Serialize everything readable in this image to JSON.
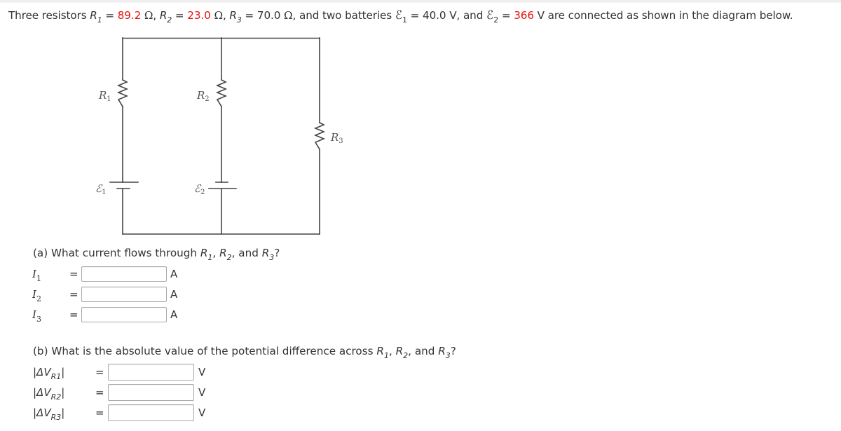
{
  "problem": {
    "prefix": "Three resistors ",
    "R1": {
      "symbol": "R",
      "sub": "1",
      "value": "89.2",
      "unit": "Ω",
      "highlight_color": "#e8120c"
    },
    "R2": {
      "symbol": "R",
      "sub": "2",
      "value": "23.0",
      "unit": "Ω",
      "highlight_color": "#e8120c"
    },
    "R3": {
      "symbol": "R",
      "sub": "3",
      "value": "70.0",
      "unit": "Ω"
    },
    "middle": ", and two batteries ",
    "E1": {
      "symbol": "ℰ",
      "sub": "1",
      "value": "40.0",
      "unit": "V"
    },
    "E2": {
      "symbol": "ℰ",
      "sub": "2",
      "value": "366",
      "unit": "V",
      "highlight_color": "#e8120c"
    },
    "suffix": " are connected as shown in the diagram below."
  },
  "circuit": {
    "labels": {
      "R1": {
        "main": "R",
        "sub": "1"
      },
      "R2": {
        "main": "R",
        "sub": "2"
      },
      "R3": {
        "main": "R",
        "sub": "3"
      },
      "E1": {
        "main": "ℰ",
        "sub": "1"
      },
      "E2": {
        "main": "ℰ",
        "sub": "2"
      }
    }
  },
  "part_a": {
    "question_prefix": "(a) What current flows through ",
    "question_suffix": "?",
    "items": [
      {
        "var": "I",
        "sub": "1",
        "eq": "=",
        "value": "",
        "unit": "A"
      },
      {
        "var": "I",
        "sub": "2",
        "eq": "=",
        "value": "",
        "unit": "A"
      },
      {
        "var": "I",
        "sub": "3",
        "eq": "=",
        "value": "",
        "unit": "A"
      }
    ]
  },
  "part_b": {
    "question_prefix": "(b) What is the absolute value of the potential difference across ",
    "question_suffix": "?",
    "items": [
      {
        "var": "|ΔV",
        "sub": "R1",
        "close": "|",
        "eq": "=",
        "value": "",
        "unit": "V"
      },
      {
        "var": "|ΔV",
        "sub": "R2",
        "close": "|",
        "eq": "=",
        "value": "",
        "unit": "V"
      },
      {
        "var": "|ΔV",
        "sub": "R3",
        "close": "|",
        "eq": "=",
        "value": "",
        "unit": "V"
      }
    ]
  },
  "common": {
    "comma": ", ",
    "and": "and ",
    "equals": " = ",
    "space": " "
  }
}
